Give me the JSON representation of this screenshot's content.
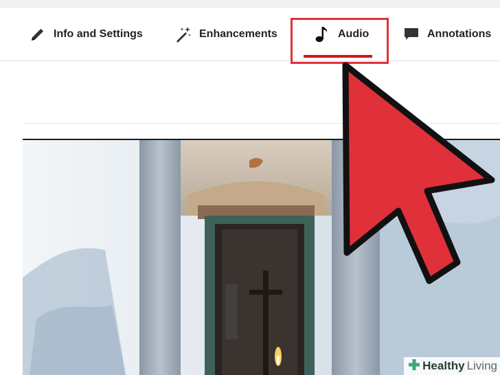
{
  "tabs": [
    {
      "label": "Info and Settings",
      "icon": "pencil-icon"
    },
    {
      "label": "Enhancements",
      "icon": "magic-wand-icon"
    },
    {
      "label": "Audio",
      "icon": "music-note-icon",
      "selected": true
    },
    {
      "label": "Annotations",
      "icon": "speech-bubble-icon"
    }
  ],
  "watermark": {
    "brand_bold": "Healthy",
    "brand_light": "Living",
    "icon": "plus-cross-icon"
  },
  "colors": {
    "selected_underline": "#cc181e",
    "highlight_box": "#e0303a",
    "cursor_fill": "#e0303a",
    "tab_text": "#222222",
    "watermark_cross": "#3aa67a"
  },
  "video": {
    "content": "thumbnail-of-abandoned-chapel-doorway"
  }
}
